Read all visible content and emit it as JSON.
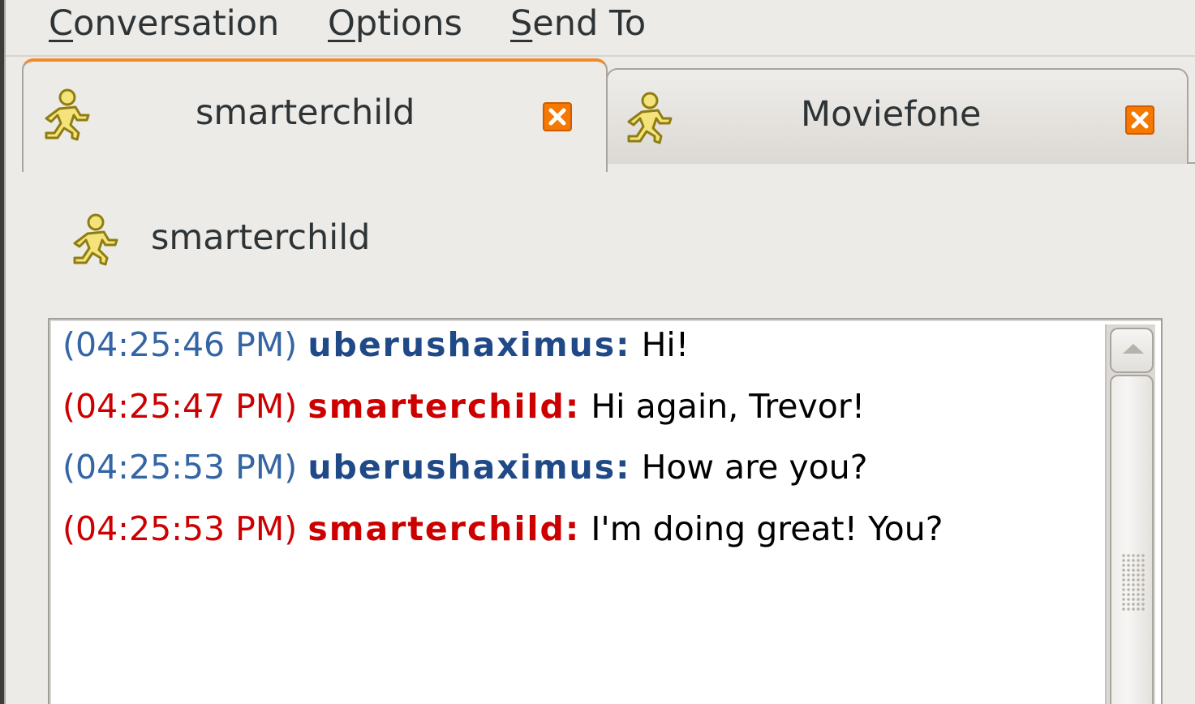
{
  "menubar": {
    "items": [
      {
        "mnemonic": "C",
        "rest": "onversation"
      },
      {
        "mnemonic": "O",
        "rest": "ptions"
      },
      {
        "mnemonic": "S",
        "rest": "end To"
      }
    ]
  },
  "tabs": [
    {
      "label": "smarterchild",
      "icon": "aim-running-man-icon",
      "close_icon": "close-icon",
      "active": true
    },
    {
      "label": "Moviefone",
      "icon": "aim-running-man-icon",
      "close_icon": "close-icon",
      "active": false
    }
  ],
  "header": {
    "buddy_name": "smarterchild",
    "icon": "aim-running-man-icon"
  },
  "messages": [
    {
      "timestamp": "(04:25:46 PM)",
      "sender": "uberushaximus:",
      "text": " Hi!",
      "color": "#204a87"
    },
    {
      "timestamp": "(04:25:47 PM)",
      "sender": "smarterchild:",
      "text": " Hi again, Trevor!",
      "color": "#cc0000"
    },
    {
      "timestamp": "(04:25:53 PM)",
      "sender": "uberushaximus:",
      "text": " How are you?",
      "color": "#204a87"
    },
    {
      "timestamp": "(04:25:53 PM)",
      "sender": "smarterchild:",
      "text": " I'm doing great! You?",
      "color": "#cc0000"
    }
  ],
  "colors": {
    "local_user": "#204a87",
    "remote_user": "#cc0000",
    "active_tab_accent": "#f08a2c",
    "close_icon": "#f57900"
  }
}
